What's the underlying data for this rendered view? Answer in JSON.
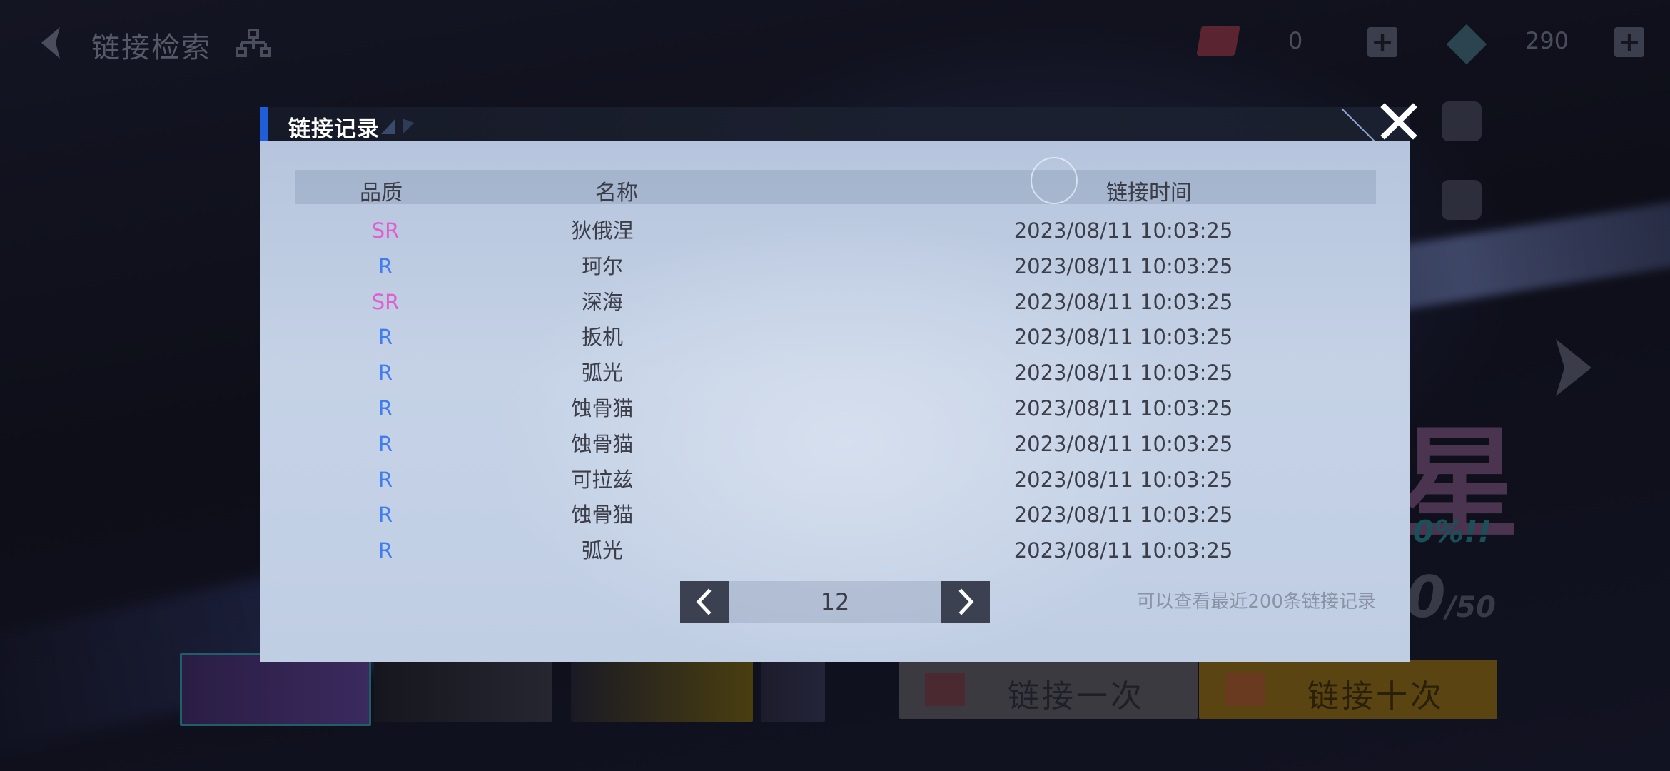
{
  "screen": {
    "title": "链接检索",
    "resources": [
      {
        "icon": "ticket-icon",
        "count": "0"
      },
      {
        "icon": "gem-icon",
        "count": "290"
      }
    ],
    "event_glyph": "星",
    "rate_text": "0%!!",
    "counter": {
      "value": "0",
      "max": "/50"
    },
    "pull_buttons": {
      "single": "链接一次",
      "ten": "链接十次"
    }
  },
  "dialog": {
    "title": "链接记录",
    "columns": {
      "quality": "品质",
      "name": "名称",
      "time": "链接时间"
    },
    "rows": [
      {
        "quality": "SR",
        "name": "狄俄涅",
        "time": "2023/08/11 10:03:25"
      },
      {
        "quality": "R",
        "name": "珂尔",
        "time": "2023/08/11 10:03:25"
      },
      {
        "quality": "SR",
        "name": "深海",
        "time": "2023/08/11 10:03:25"
      },
      {
        "quality": "R",
        "name": "扳机",
        "time": "2023/08/11 10:03:25"
      },
      {
        "quality": "R",
        "name": "弧光",
        "time": "2023/08/11 10:03:25"
      },
      {
        "quality": "R",
        "name": "蚀骨猫",
        "time": "2023/08/11 10:03:25"
      },
      {
        "quality": "R",
        "name": "蚀骨猫",
        "time": "2023/08/11 10:03:25"
      },
      {
        "quality": "R",
        "name": "可拉兹",
        "time": "2023/08/11 10:03:25"
      },
      {
        "quality": "R",
        "name": "蚀骨猫",
        "time": "2023/08/11 10:03:25"
      },
      {
        "quality": "R",
        "name": "弧光",
        "time": "2023/08/11 10:03:25"
      }
    ],
    "page": "12",
    "hint": "可以查看最近200条链接记录"
  },
  "colors": {
    "SR": "#e05fd0",
    "R": "#3f7df0",
    "accent": "#1f5ed8"
  }
}
